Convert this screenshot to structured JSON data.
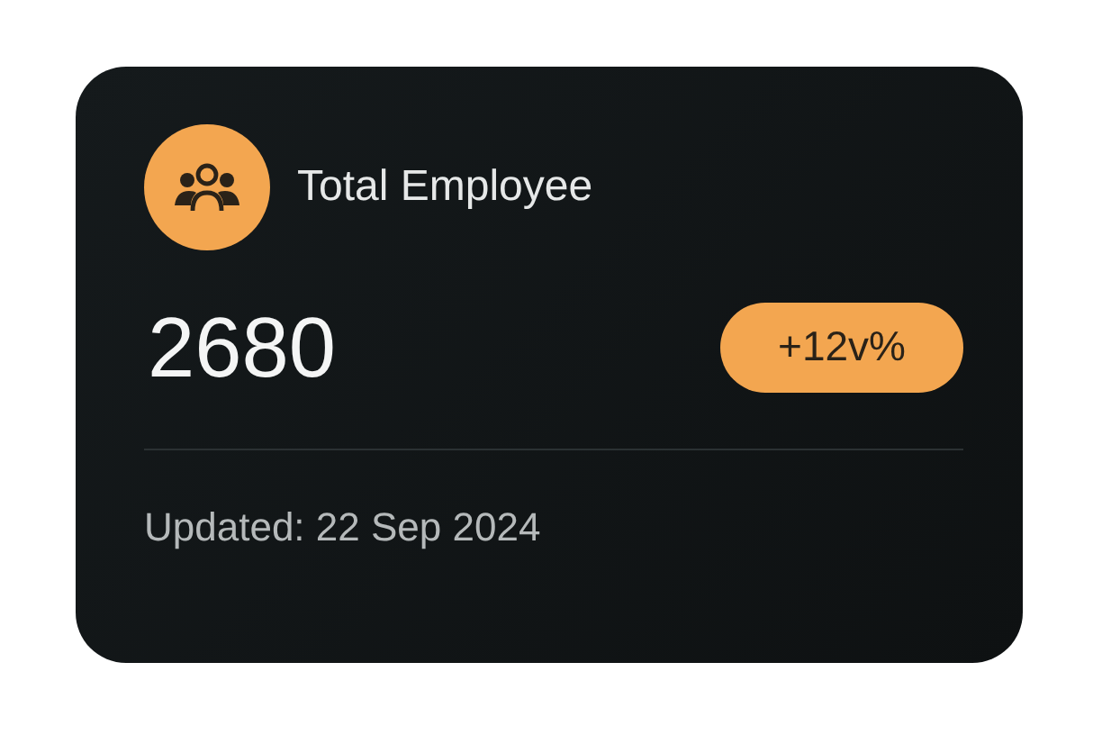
{
  "card": {
    "title": "Total Employee",
    "value": "2680",
    "badge": "+12v%",
    "updated": "Updated: 22 Sep 2024"
  }
}
